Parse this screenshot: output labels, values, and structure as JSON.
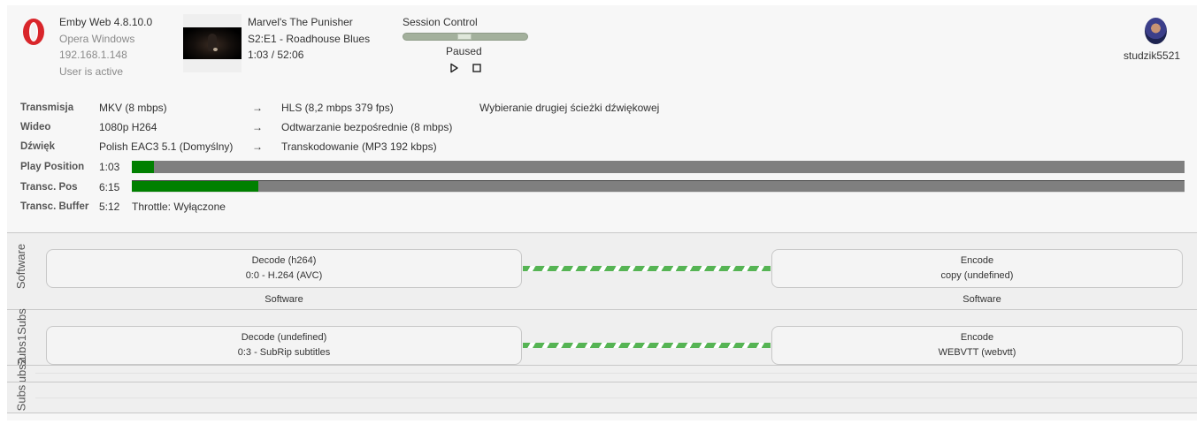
{
  "client": {
    "app": "Emby Web 4.8.10.0",
    "device": "Opera Windows",
    "ip": "192.168.1.148",
    "activity": "User is active",
    "icon": "opera-icon",
    "icon_color": "#d9262b"
  },
  "media": {
    "title": "Marvel's The Punisher",
    "episode": "S2:E1 - Roadhouse Blues",
    "time": "1:03 / 52:06"
  },
  "session": {
    "title": "Session Control",
    "status": "Paused",
    "progress": 0.49,
    "play_icon": "play-icon",
    "stop_icon": "stop-icon"
  },
  "user": {
    "name": "studzik5521",
    "avatar": "user-avatar"
  },
  "stream": {
    "transmission": {
      "label": "Transmisja",
      "source": "MKV (8 mbps)",
      "arrow": "→",
      "target": "HLS (8,2 mbps 379 fps)",
      "reason": "Wybieranie drugiej ścieżki dźwiękowej"
    },
    "video": {
      "label": "Wideo",
      "source": "1080p H264",
      "arrow": "→",
      "target": "Odtwarzanie bezpośrednie (8 mbps)"
    },
    "audio": {
      "label": "Dźwięk",
      "source": "Polish EAC3 5.1 (Domyślny)",
      "arrow": "→",
      "target": "Transkodowanie (MP3 192 kbps)"
    },
    "play_position": {
      "label": "Play Position",
      "value": "1:03",
      "progress": 0.021
    },
    "transc_pos": {
      "label": "Transc. Pos",
      "value": "6:15",
      "progress": 0.12
    },
    "transc_buffer": {
      "label": "Transc. Buffer",
      "value": "5:12",
      "throttle": "Throttle: Wyłączone"
    }
  },
  "pipeline": {
    "lanes": [
      {
        "label": "Software",
        "decode": {
          "title": "Decode (h264)",
          "detail": "0:0 - H.264 (AVC)"
        },
        "encode": {
          "title": "Encode",
          "detail": "copy (undefined)"
        },
        "decode_hw": "Software",
        "encode_hw": "Software"
      },
      {
        "label": "Subs1Subs",
        "decode": {
          "title": "Decode (undefined)",
          "detail": "0:3 - SubRip subtitles"
        },
        "encode": {
          "title": "Encode",
          "detail": "WEBVTT (webvtt)"
        }
      }
    ],
    "extra_lanes": [
      "Subs2",
      "Subs"
    ],
    "link_color": "#56b454"
  }
}
